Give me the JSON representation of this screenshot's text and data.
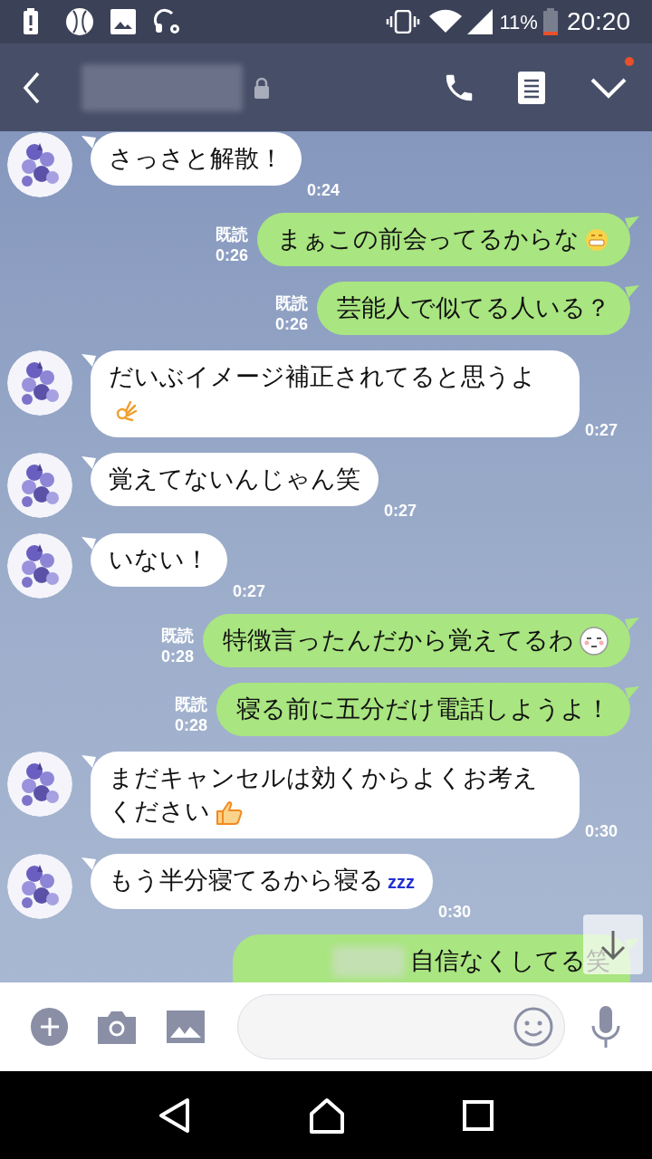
{
  "status_bar": {
    "battery": "11%",
    "time": "20:20"
  },
  "messages": [
    {
      "kind": "received",
      "text": "さっさと解散！",
      "time": "0:24"
    },
    {
      "kind": "sent",
      "text": "まぁこの前会ってるからな",
      "read": "既読",
      "time": "0:26",
      "emoji": {
        "kind": "grin"
      }
    },
    {
      "kind": "sent",
      "text": "芸能人で似てる人いる？",
      "read": "既読",
      "time": "0:26"
    },
    {
      "kind": "received",
      "text": "だいぶイメージ補正されてると思うよ",
      "time": "0:27",
      "emoji": {
        "kind": "ok"
      }
    },
    {
      "kind": "received",
      "text": "覚えてないんじゃん笑",
      "time": "0:27"
    },
    {
      "kind": "received",
      "text": "いない！",
      "time": "0:27"
    },
    {
      "kind": "sent",
      "text": "特徴言ったんだから覚えてるわ",
      "read": "既読",
      "time": "0:28",
      "emoji": {
        "kind": "face"
      }
    },
    {
      "kind": "sent",
      "text": "寝る前に五分だけ電話しようよ！",
      "read": "既読",
      "time": "0:28"
    },
    {
      "kind": "received",
      "text": "まだキャンセルは効くからよくお考えください",
      "time": "0:30",
      "emoji": {
        "kind": "thumbs"
      }
    },
    {
      "kind": "received",
      "text": "もう半分寝てるから寝る",
      "time": "0:30",
      "emoji": {
        "kind": "text",
        "text": "zzz"
      }
    },
    {
      "kind": "sent",
      "text": "自信なくしてる笑",
      "partial": true
    }
  ]
}
